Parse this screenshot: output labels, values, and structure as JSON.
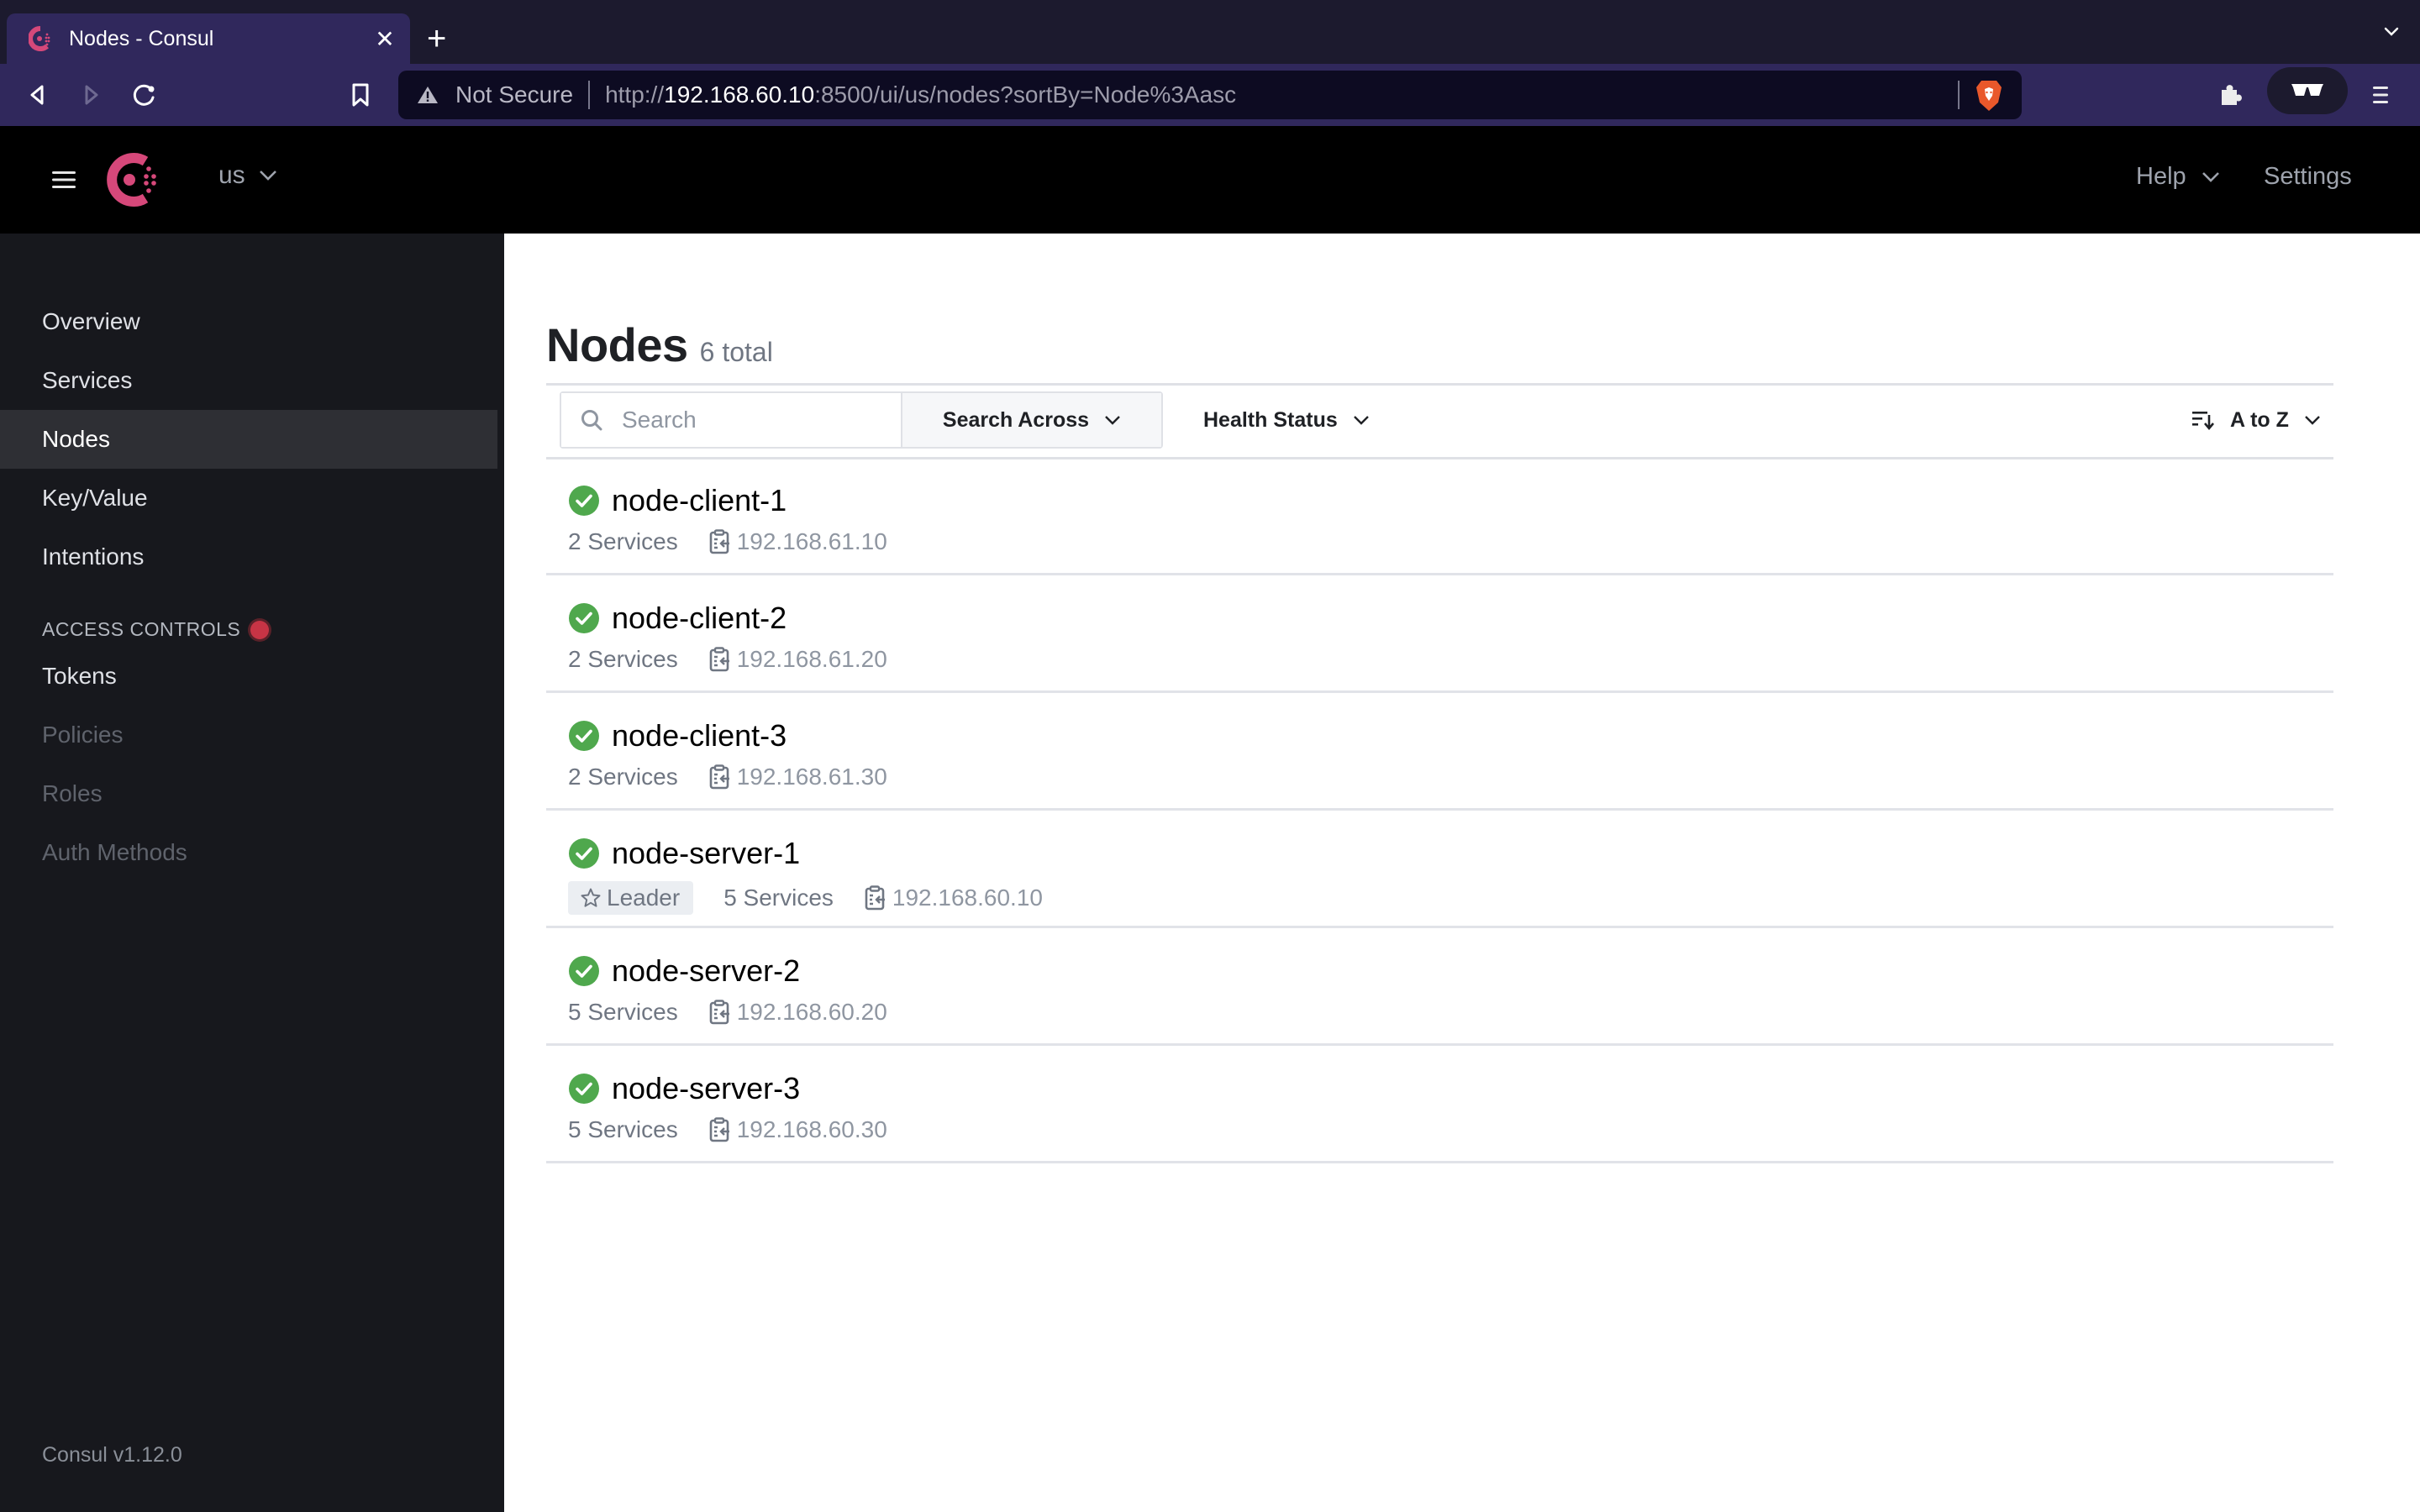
{
  "browser": {
    "tab_title": "Nodes - Consul",
    "tab_close": "✕",
    "new_tab": "+",
    "not_secure": "Not Secure",
    "url_scheme": "http://",
    "url_host": "192.168.60.10",
    "url_rest": ":8500/ui/us/nodes?sortBy=Node%3Aasc"
  },
  "header": {
    "datacenter": "us",
    "help_label": "Help",
    "settings_label": "Settings"
  },
  "sidebar": {
    "items": [
      {
        "label": "Overview"
      },
      {
        "label": "Services"
      },
      {
        "label": "Nodes",
        "active": true
      },
      {
        "label": "Key/Value"
      },
      {
        "label": "Intentions"
      }
    ],
    "access_heading": "ACCESS CONTROLS",
    "access_items": [
      {
        "label": "Tokens",
        "enabled": true
      },
      {
        "label": "Policies",
        "enabled": false
      },
      {
        "label": "Roles",
        "enabled": false
      },
      {
        "label": "Auth Methods",
        "enabled": false
      }
    ],
    "version": "Consul v1.12.0"
  },
  "main": {
    "title": "Nodes",
    "total": "6 total",
    "search_placeholder": "Search",
    "search_across_label": "Search Across",
    "health_filter_label": "Health Status",
    "sort_label": "A to Z"
  },
  "nodes": [
    {
      "name": "node-client-1",
      "status": "passing",
      "leader": false,
      "services": "2 Services",
      "address": "192.168.61.10"
    },
    {
      "name": "node-client-2",
      "status": "passing",
      "leader": false,
      "services": "2 Services",
      "address": "192.168.61.20"
    },
    {
      "name": "node-client-3",
      "status": "passing",
      "leader": false,
      "services": "2 Services",
      "address": "192.168.61.30"
    },
    {
      "name": "node-server-1",
      "status": "passing",
      "leader": true,
      "leader_label": "Leader",
      "services": "5 Services",
      "address": "192.168.60.10"
    },
    {
      "name": "node-server-2",
      "status": "passing",
      "leader": false,
      "services": "5 Services",
      "address": "192.168.60.20"
    },
    {
      "name": "node-server-3",
      "status": "passing",
      "leader": false,
      "services": "5 Services",
      "address": "192.168.60.30"
    }
  ],
  "colors": {
    "brand": "#d6487a",
    "passing": "#4fa84d",
    "acl_alert": "#c73445"
  }
}
